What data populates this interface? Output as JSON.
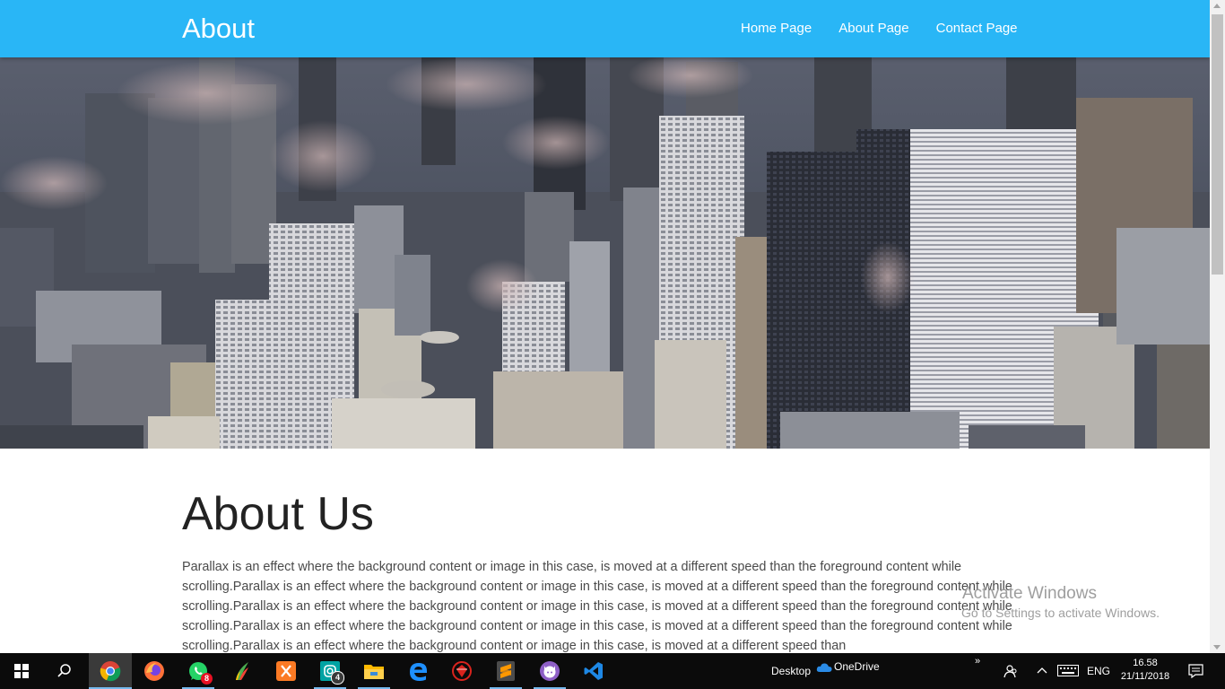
{
  "navbar": {
    "brand": "About",
    "links": [
      "Home Page",
      "About Page",
      "Contact Page"
    ]
  },
  "content": {
    "title": "About Us",
    "paragraph": "Parallax is an effect where the background content or image in this case, is moved at a different speed than the foreground content while scrolling.Parallax is an effect where the background content or image in this case, is moved at a different speed than the foreground content while scrolling.Parallax is an effect where the background content or image in this case, is moved at a different speed than the foreground content while scrolling.Parallax is an effect where the background content or image in this case, is moved at a different speed than the foreground content while scrolling.Parallax is an effect where the background content or image in this case, is moved at a different speed than"
  },
  "watermark": {
    "title": "Activate Windows",
    "subtitle": "Go to Settings to activate Windows."
  },
  "taskbar": {
    "apps": [
      {
        "name": "chrome-icon",
        "badge": ""
      },
      {
        "name": "firefox-icon",
        "badge": ""
      },
      {
        "name": "whatsapp-icon",
        "badge": "8"
      },
      {
        "name": "coreldraw-icon",
        "badge": ""
      },
      {
        "name": "xampp-icon",
        "badge": ""
      },
      {
        "name": "instagram-icon",
        "badge": "4"
      },
      {
        "name": "file-explorer-icon",
        "badge": ""
      },
      {
        "name": "edge-icon",
        "badge": ""
      },
      {
        "name": "ruby-app-icon",
        "badge": ""
      },
      {
        "name": "sublime-text-icon",
        "badge": ""
      },
      {
        "name": "github-desktop-icon",
        "badge": ""
      },
      {
        "name": "vscode-icon",
        "badge": ""
      }
    ],
    "tray": {
      "desktop_label": "Desktop",
      "onedrive_label": "OneDrive",
      "language": "ENG",
      "time": "16.58",
      "date": "21/11/2018"
    }
  },
  "colors": {
    "navbar": "#29b6f6",
    "taskbar": "#0b0b0b",
    "accent": "#76b9ed"
  }
}
